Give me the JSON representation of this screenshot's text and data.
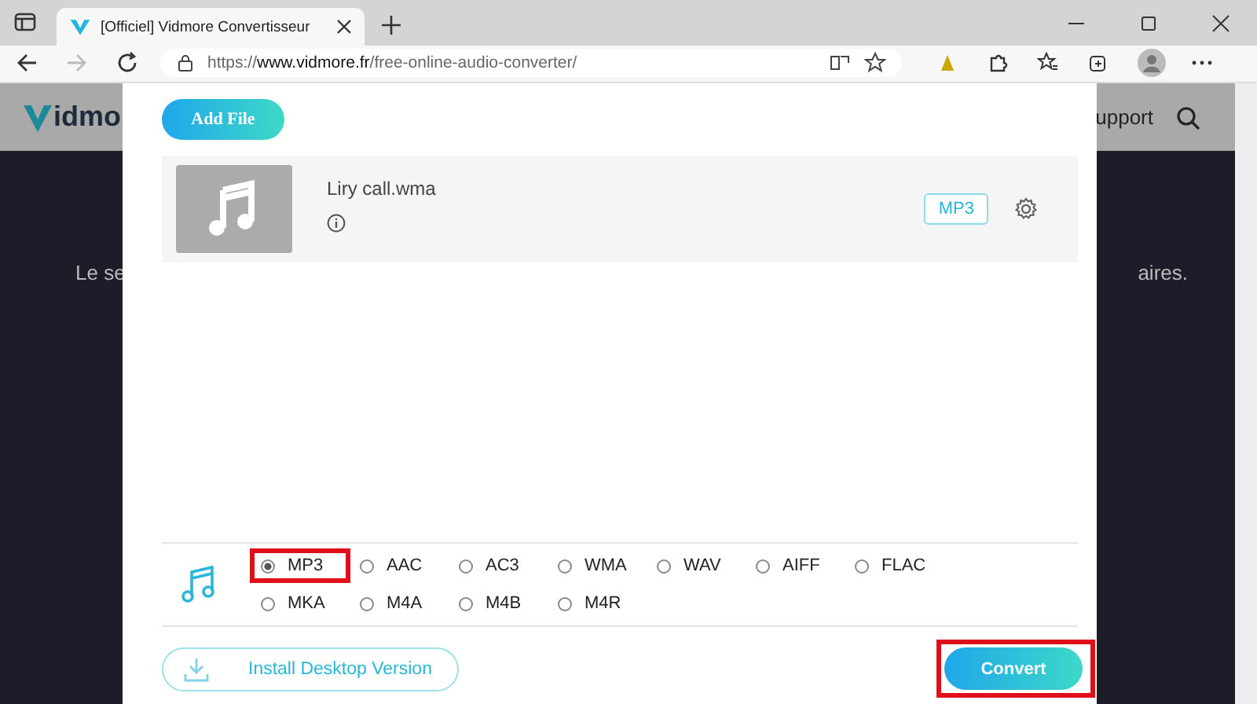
{
  "browser": {
    "tab_title": "[Officiel] Vidmore Convertisseur",
    "url_prefix": "https://",
    "url_host": "www.vidmore.fr",
    "url_path": "/free-online-audio-converter/"
  },
  "background": {
    "logo_text": "idmo",
    "nav_text": "upport",
    "text_left": "Le se",
    "text_right": "aires."
  },
  "dialog": {
    "add_file": "Add File",
    "files": [
      {
        "name": "Liry call.wma",
        "format": "MP3"
      }
    ],
    "formats": [
      {
        "label": "MP3",
        "selected": true,
        "highlight": true
      },
      {
        "label": "AAC",
        "selected": false,
        "highlight": false
      },
      {
        "label": "AC3",
        "selected": false,
        "highlight": false
      },
      {
        "label": "WMA",
        "selected": false,
        "highlight": false
      },
      {
        "label": "WAV",
        "selected": false,
        "highlight": false
      },
      {
        "label": "AIFF",
        "selected": false,
        "highlight": false
      },
      {
        "label": "FLAC",
        "selected": false,
        "highlight": false
      },
      {
        "label": "MKA",
        "selected": false,
        "highlight": false
      },
      {
        "label": "M4A",
        "selected": false,
        "highlight": false
      },
      {
        "label": "M4B",
        "selected": false,
        "highlight": false
      },
      {
        "label": "M4R",
        "selected": false,
        "highlight": false
      }
    ],
    "install": "Install Desktop Version",
    "convert": {
      "label": "Convert",
      "highlight": true
    }
  }
}
